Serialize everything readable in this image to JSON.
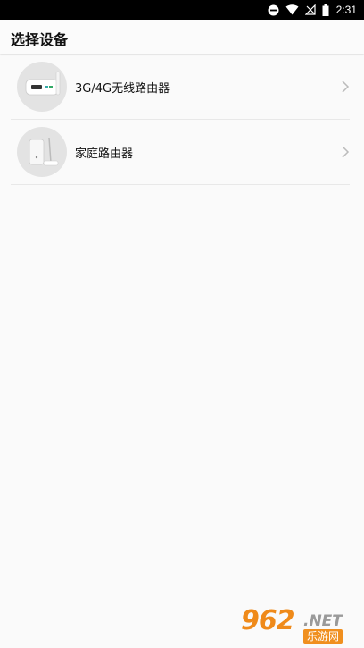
{
  "status_bar": {
    "time": "2:31",
    "icons": [
      "dnd-icon",
      "wifi-icon",
      "no-signal-icon",
      "battery-icon"
    ]
  },
  "header": {
    "title": "选择设备"
  },
  "devices": [
    {
      "label": "3G/4G无线路由器",
      "icon": "mobile-router-image"
    },
    {
      "label": "家庭路由器",
      "icon": "home-router-image"
    }
  ],
  "watermark": {
    "number": "962",
    "suffix": ".NET",
    "subtitle": "乐游网"
  }
}
